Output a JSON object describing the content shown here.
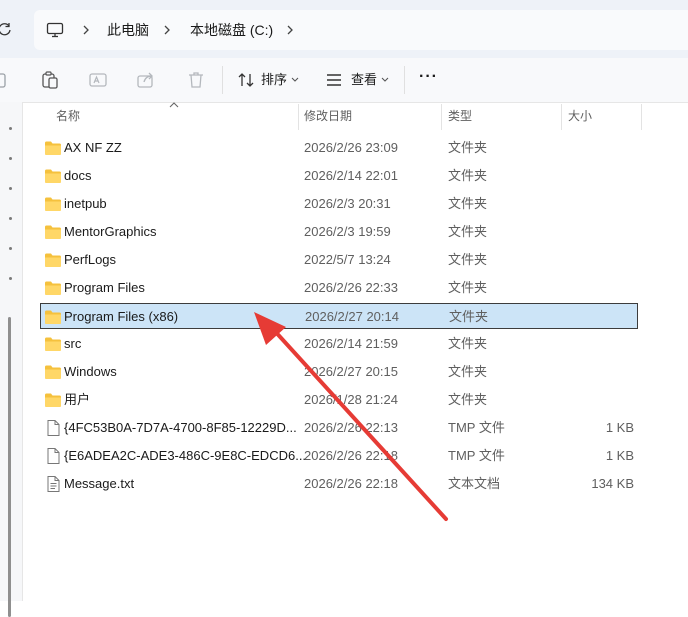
{
  "address_bar": {
    "crumbs": [
      "此电脑",
      "本地磁盘 (C:)"
    ]
  },
  "toolbar": {
    "sort_label": "排序",
    "view_label": "查看",
    "more_label": "···"
  },
  "columns": {
    "name": "名称",
    "date": "修改日期",
    "type": "类型",
    "size": "大小"
  },
  "files": [
    {
      "name": "AX NF ZZ",
      "date": "2026/2/26 23:09",
      "type": "文件夹",
      "size": "",
      "icon": "folder-icon"
    },
    {
      "name": "docs",
      "date": "2026/2/14 22:01",
      "type": "文件夹",
      "size": "",
      "icon": "folder-icon"
    },
    {
      "name": "inetpub",
      "date": "2026/2/3 20:31",
      "type": "文件夹",
      "size": "",
      "icon": "folder-icon"
    },
    {
      "name": "MentorGraphics",
      "date": "2026/2/3 19:59",
      "type": "文件夹",
      "size": "",
      "icon": "folder-icon"
    },
    {
      "name": "PerfLogs",
      "date": "2022/5/7 13:24",
      "type": "文件夹",
      "size": "",
      "icon": "folder-icon"
    },
    {
      "name": "Program Files",
      "date": "2026/2/26 22:33",
      "type": "文件夹",
      "size": "",
      "icon": "folder-icon"
    },
    {
      "name": "Program Files (x86)",
      "date": "2026/2/27 20:14",
      "type": "文件夹",
      "size": "",
      "icon": "folder-icon",
      "selected": true
    },
    {
      "name": "src",
      "date": "2026/2/14 21:59",
      "type": "文件夹",
      "size": "",
      "icon": "folder-icon"
    },
    {
      "name": "Windows",
      "date": "2026/2/27 20:15",
      "type": "文件夹",
      "size": "",
      "icon": "folder-icon"
    },
    {
      "name": "用户",
      "date": "2026/1/28 21:24",
      "type": "文件夹",
      "size": "",
      "icon": "folder-icon"
    },
    {
      "name": "{4FC53B0A-7D7A-4700-8F85-12229D...",
      "date": "2026/2/26 22:13",
      "type": "TMP 文件",
      "size": "1 KB",
      "icon": "file-icon"
    },
    {
      "name": "{E6ADEA2C-ADE3-486C-9E8C-EDCD6...",
      "date": "2026/2/26 22:18",
      "type": "TMP 文件",
      "size": "1 KB",
      "icon": "file-icon"
    },
    {
      "name": "Message.txt",
      "date": "2026/2/26 22:18",
      "type": "文本文档",
      "size": "134 KB",
      "icon": "text-file-icon"
    }
  ],
  "colors": {
    "selection": "#cce4f7",
    "folder": "#f5c13d",
    "annotation_arrow": "#e63b35"
  }
}
